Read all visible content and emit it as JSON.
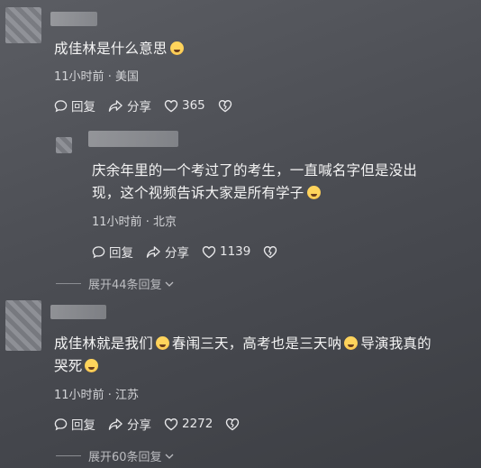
{
  "comments": [
    {
      "text": "成佳林是什么意思",
      "emoji_after": "laugh-cry-emoji",
      "time": "11小时前",
      "location": "美国",
      "reply_label": "回复",
      "share_label": "分享",
      "likes": "365"
    },
    {
      "text_line1": "庆余年里的一个考过了的考生，一直喊名字但是没出",
      "text_line2": "现，这个视频告诉大家是所有学子",
      "emoji_after": "crying-emoji",
      "time": "11小时前",
      "location": "北京",
      "reply_label": "回复",
      "share_label": "分享",
      "likes": "1139",
      "expand_label": "展开44条回复"
    },
    {
      "text_part1": "成佳林就是我们",
      "text_part2": "春闱三天，高考也是三天呐",
      "text_part3": "导演我真的",
      "text_line2": "哭死",
      "time": "11小时前",
      "location": "江苏",
      "reply_label": "回复",
      "share_label": "分享",
      "likes": "2272",
      "expand_label": "展开60条回复"
    }
  ],
  "separator": "·",
  "colors": {
    "background": "#4d4f55",
    "text": "#f4f4f4",
    "meta": "#d3d4d7",
    "emoji": "#ffd45c"
  }
}
